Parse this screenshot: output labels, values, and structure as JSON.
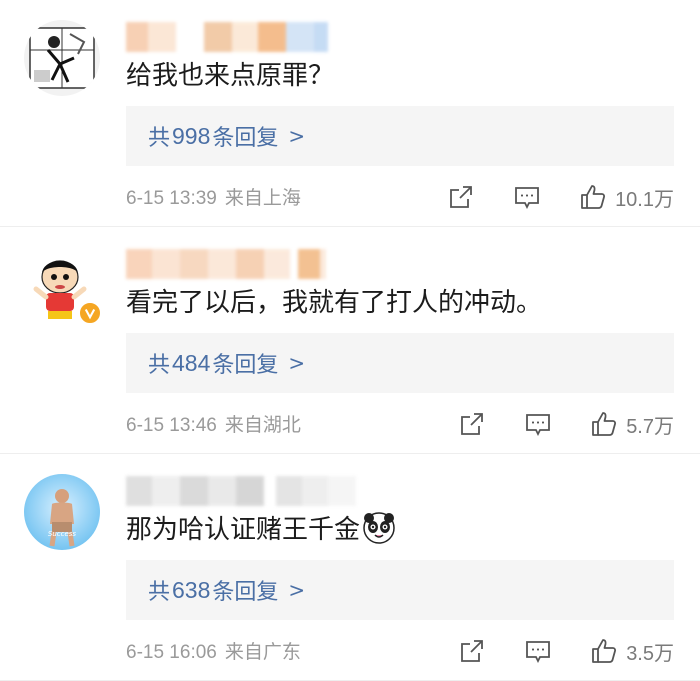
{
  "comments": [
    {
      "text": "给我也来点原罪？",
      "reply_prefix": "共",
      "reply_count": "998",
      "reply_suffix": "条回复",
      "reply_chevron": ">",
      "date": "6-15 13:39",
      "location": "来自上海",
      "likes": "10.1万"
    },
    {
      "text": "看完了以后，我就有了打人的冲动。",
      "reply_prefix": "共",
      "reply_count": "484",
      "reply_suffix": "条回复",
      "reply_chevron": ">",
      "date": "6-15 13:46",
      "location": "来自湖北",
      "likes": "5.7万"
    },
    {
      "text": "那为哈认证赌王千金",
      "reply_prefix": "共",
      "reply_count": "638",
      "reply_suffix": "条回复",
      "reply_chevron": ">",
      "date": "6-15 16:06",
      "location": "来自广东",
      "likes": "3.5万"
    }
  ],
  "icons": {
    "share": "share-icon",
    "comment": "comment-icon",
    "like": "thumbs-up-icon",
    "verified": "verified-badge-icon",
    "emoji": "panda-emoji-icon"
  },
  "colors": {
    "link": "#4a6fa5",
    "meta": "#9a9a9a",
    "reply_bg": "#f5f5f5",
    "verified": "#f5a623"
  }
}
